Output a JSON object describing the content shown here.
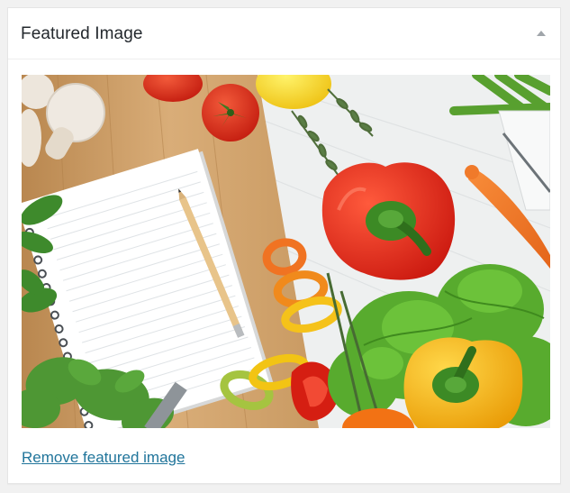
{
  "metabox": {
    "title": "Featured Image",
    "toggle_icon": "triangle-up-icon"
  },
  "image": {
    "subject": "vegetables-and-notebook-photo"
  },
  "actions": {
    "remove_label": "Remove featured image"
  },
  "colors": {
    "link": "#21759b",
    "title": "#23282d",
    "panel_border": "#e5e5e5",
    "page_background": "#f1f1f1"
  }
}
